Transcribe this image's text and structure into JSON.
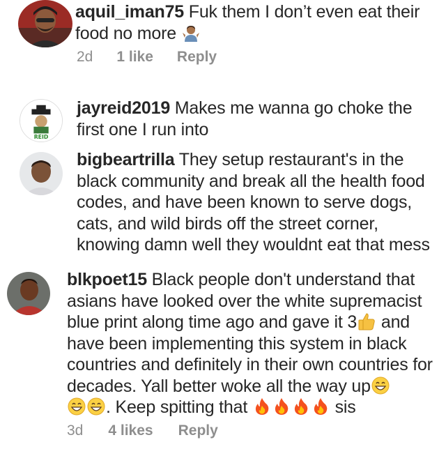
{
  "comments": [
    {
      "username": "aquil_iman75",
      "text": "Fuk them I don’t even eat their food no more",
      "emoji": "person-shrugging",
      "age": "2d",
      "likes": "1 like",
      "reply": "Reply"
    },
    {
      "username": "jayreid2019",
      "text": "Makes me wanna go choke the first one I run into"
    },
    {
      "username": "bigbeartrilla",
      "text": "They setup restaurant's in the black community and break all the health food codes, and have been known to serve dogs, cats, and wild birds off the street corner, knowing damn well they wouldnt eat that mess"
    },
    {
      "username": "blkpoet15",
      "text_1": "Black people don't understand that asians have looked over the white supremacist blue print along time ago and gave it 3",
      "text_2": "and have been implementing this system in black countries and definitely in their own countries for decades.  Yall better woke all the way up",
      "text_3": ". Keep spitting that",
      "text_4": "sis",
      "emojis": [
        "thumbs-up",
        "grinning-face",
        "grinning-face",
        "grinning-face",
        "fire",
        "fire",
        "fire",
        "fire"
      ],
      "age": "3d",
      "likes": "4 likes",
      "reply": "Reply"
    }
  ],
  "colors": {
    "text": "#262626",
    "meta": "#8e8e8e"
  }
}
